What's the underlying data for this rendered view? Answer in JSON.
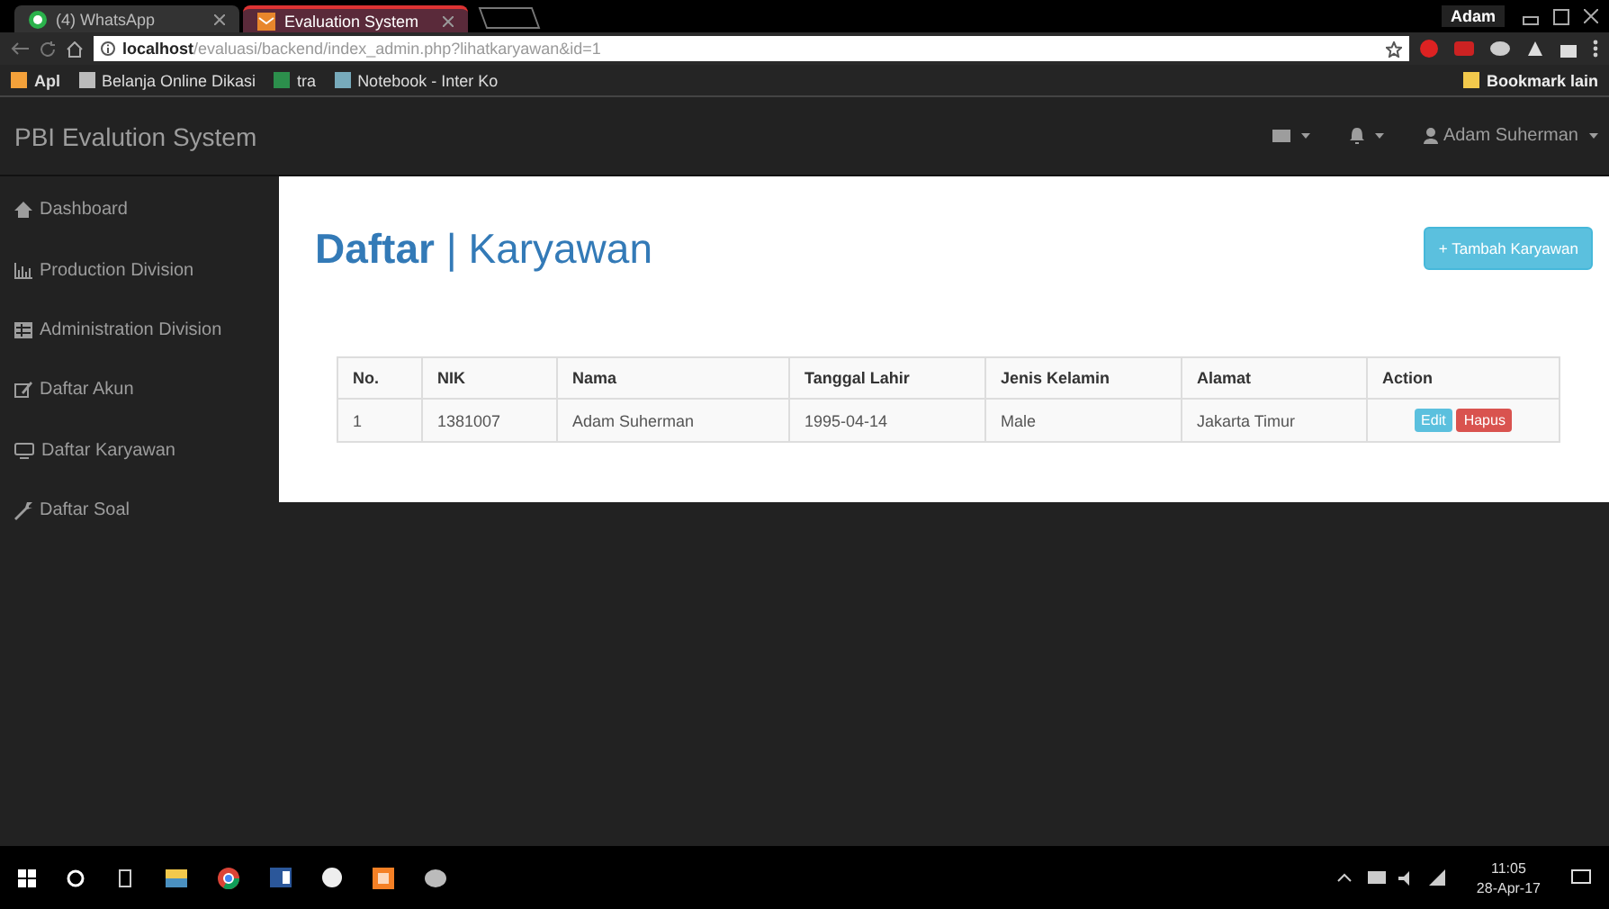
{
  "browser": {
    "tabs": [
      {
        "label": "(4) WhatsApp",
        "selected": false
      },
      {
        "label": "Evaluation System",
        "selected": true
      }
    ],
    "profile": "Adam",
    "address": "**localhost**/evaluasi/backend/index_admin.php?lihatkaryawan&id=1",
    "bookmarks": [
      "Apl",
      "Belanja Online Dikasi",
      "tra",
      "Notebook - Inter Ko"
    ],
    "other_bookmarks": "Bookmark lain"
  },
  "navbar": {
    "brand": "PBI Evalution System",
    "user": "Adam Suherman"
  },
  "sidebar": {
    "items": [
      "Dashboard",
      "Production Division",
      "Administration Division",
      "Daftar Akun",
      "Daftar Karyawan",
      "Daftar Soal"
    ]
  },
  "page": {
    "title": "**Daftar** | Karyawan",
    "add_button": "+ Tambah Karyawan",
    "table": {
      "columns": [
        "No.",
        "NIK",
        "Nama",
        "Tanggal Lahir",
        "Jenis Kelamin",
        "Alamat",
        "Action"
      ],
      "rows": [
        {
          "cells": [
            "1",
            "1381007",
            "Adam Suherman",
            "1995-04-14",
            "Male",
            "Jakarta Timur"
          ],
          "actions": [
            {
              "label": "Edit",
              "kind": "info"
            },
            {
              "label": "Hapus",
              "kind": "danger"
            }
          ]
        }
      ]
    }
  },
  "taskbar": {
    "time": "11:05",
    "date": "28-Apr-17"
  }
}
